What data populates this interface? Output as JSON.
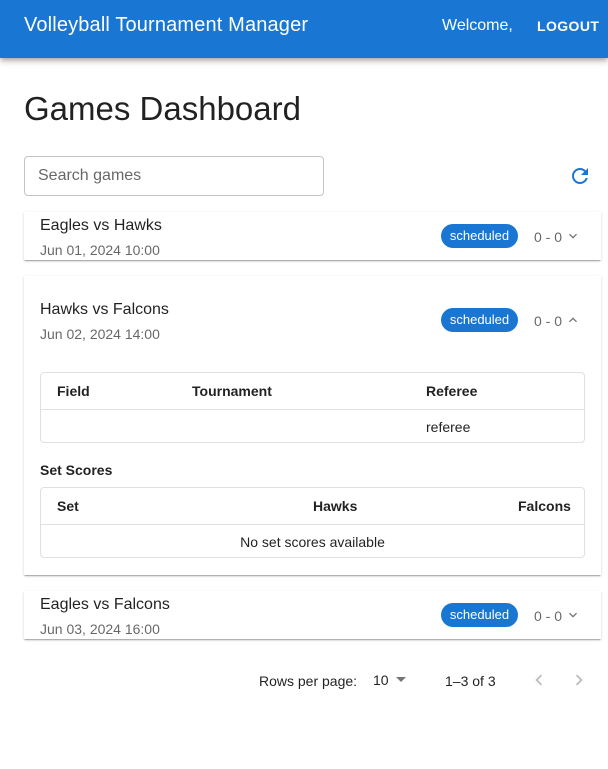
{
  "app": {
    "title": "Volleyball Tournament Manager",
    "welcome": "Welcome,",
    "logout_label": "LOGOUT",
    "primary_color": "#1976d2"
  },
  "page": {
    "title": "Games Dashboard"
  },
  "search": {
    "placeholder": "Search games",
    "value": ""
  },
  "icons": {
    "refresh": "refresh-icon",
    "expand": "chevron-down-icon",
    "collapse": "chevron-up-icon",
    "prev": "chevron-left-icon",
    "next": "chevron-right-icon"
  },
  "games": [
    {
      "title": "Eagles vs Hawks",
      "date": "Jun 01, 2024 10:00",
      "status": "scheduled",
      "score": "0 - 0",
      "expanded": false
    },
    {
      "title": "Hawks vs Falcons",
      "date": "Jun 02, 2024 14:00",
      "status": "scheduled",
      "score": "0 - 0",
      "expanded": true,
      "details": {
        "headers": [
          "Field",
          "Tournament",
          "Referee"
        ],
        "values": [
          "",
          "",
          "referee"
        ]
      },
      "set_scores": {
        "label": "Set Scores",
        "headers": [
          "Set",
          "Hawks",
          "Falcons"
        ],
        "empty_text": "No set scores available"
      }
    },
    {
      "title": "Eagles vs Falcons",
      "date": "Jun 03, 2024 16:00",
      "status": "scheduled",
      "score": "0 - 0",
      "expanded": false
    }
  ],
  "pagination": {
    "rows_per_page_label": "Rows per page:",
    "rows_per_page": "10",
    "range": "1–3 of 3"
  }
}
